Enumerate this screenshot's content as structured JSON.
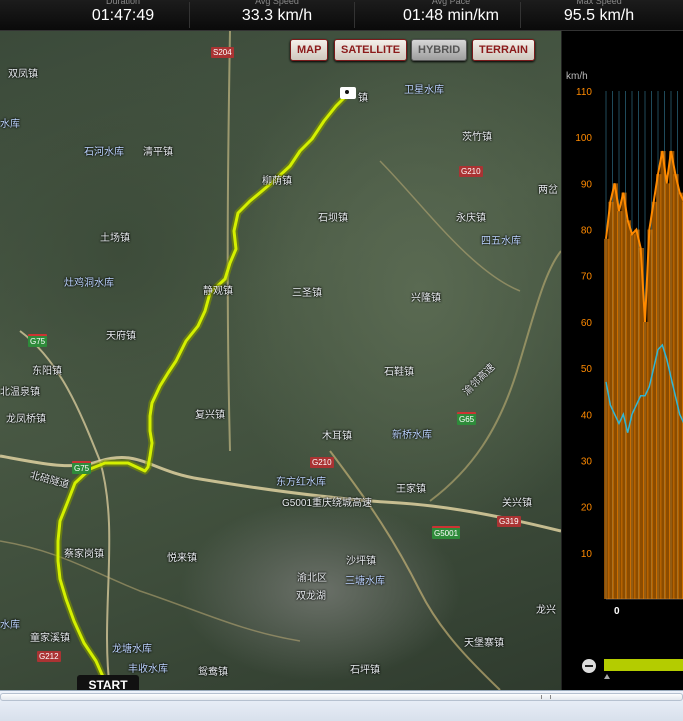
{
  "stats": [
    {
      "label": "Duration",
      "value": "01:47:49"
    },
    {
      "label": "Avg Speed",
      "value": "33.3 km/h"
    },
    {
      "label": "Avg Pace",
      "value": "01:48 min/km"
    },
    {
      "label": "Max Speed",
      "value": "95.5 km/h"
    }
  ],
  "map": {
    "types": [
      "MAP",
      "SATELLITE",
      "HYBRID",
      "TERRAIN"
    ],
    "active_type": "HYBRID",
    "start_label": "START",
    "camera_icon": "camera-icon",
    "route_color": "#d4f000",
    "towns": [
      {
        "t": "双凤镇",
        "w": false
      },
      {
        "t": "水库",
        "w": true
      },
      {
        "t": "石河水库",
        "w": true
      },
      {
        "t": "清平镇",
        "w": false
      },
      {
        "t": "土场镇",
        "w": false
      },
      {
        "t": "灶鸡洞水库",
        "w": true
      },
      {
        "t": "天府镇",
        "w": false
      },
      {
        "t": "东阳镇",
        "w": false
      },
      {
        "t": "北温泉镇",
        "w": false
      },
      {
        "t": "龙凤桥镇",
        "w": false
      },
      {
        "t": "柳荫镇",
        "w": false
      },
      {
        "t": "石坝镇",
        "w": false
      },
      {
        "t": "静观镇",
        "w": false
      },
      {
        "t": "三圣镇",
        "w": false
      },
      {
        "t": "复兴镇",
        "w": false
      },
      {
        "t": "卫星水库",
        "w": true
      },
      {
        "t": "茨竹镇",
        "w": false
      },
      {
        "t": "永庆镇",
        "w": false
      },
      {
        "t": "四五水库",
        "w": true
      },
      {
        "t": "兴隆镇",
        "w": false
      },
      {
        "t": "石鞋镇",
        "w": false
      },
      {
        "t": "木耳镇",
        "w": false
      },
      {
        "t": "新桥水库",
        "w": true
      },
      {
        "t": "东方红水库",
        "w": true
      },
      {
        "t": "王家镇",
        "w": false
      },
      {
        "t": "关兴镇",
        "w": false
      },
      {
        "t": "蔡家岗镇",
        "w": false
      },
      {
        "t": "悦来镇",
        "w": false
      },
      {
        "t": "沙坪镇",
        "w": false
      },
      {
        "t": "渝北区",
        "w": false
      },
      {
        "t": "三塘水库",
        "w": true
      },
      {
        "t": "双龙湖",
        "w": false
      },
      {
        "t": "童家溪镇",
        "w": false
      },
      {
        "t": "龙塘水库",
        "w": true
      },
      {
        "t": "丰收水库",
        "w": true
      },
      {
        "t": "鸳鸯镇",
        "w": false
      },
      {
        "t": "石坪镇",
        "w": false
      },
      {
        "t": "天堡寨镇",
        "w": false
      },
      {
        "t": "镇",
        "w": false
      },
      {
        "t": "两岔",
        "w": false
      },
      {
        "t": "北碚隧道",
        "w": false
      },
      {
        "t": "G5001重庆绕城高速",
        "w": false
      },
      {
        "t": "水库",
        "w": true
      },
      {
        "t": "渝邻高速",
        "w": false
      },
      {
        "t": "龙兴",
        "w": false
      },
      {
        "t": "水库",
        "w": true
      }
    ],
    "shields": [
      {
        "t": "S204",
        "c": "red"
      },
      {
        "t": "G210",
        "c": "red"
      },
      {
        "t": "G75",
        "c": "green"
      },
      {
        "t": "G65",
        "c": "green"
      },
      {
        "t": "G210",
        "c": "red"
      },
      {
        "t": "G5001",
        "c": "green"
      },
      {
        "t": "G319",
        "c": "red"
      },
      {
        "t": "G212",
        "c": "red"
      },
      {
        "t": "G75",
        "c": "green"
      }
    ]
  },
  "chart_data": {
    "type": "area",
    "ylabel": "km/h",
    "yticks": [
      10,
      20,
      30,
      40,
      50,
      60,
      70,
      80,
      90,
      100,
      110
    ],
    "ylim": [
      0,
      110
    ],
    "xticks": [
      "0"
    ],
    "series": [
      {
        "color": "#ff8a00",
        "values": [
          78,
          86,
          90,
          84,
          88,
          82,
          79,
          80,
          76,
          60,
          80,
          86,
          92,
          97,
          90,
          97,
          92,
          88,
          86
        ]
      },
      {
        "color": "#2fb6d6",
        "values": [
          47,
          42,
          40,
          38,
          40,
          36,
          40,
          42,
          44,
          44,
          46,
          50,
          54,
          55,
          52,
          48,
          44,
          40,
          38
        ]
      }
    ]
  },
  "zoom": {
    "minus_icon": "zoom-out-icon"
  }
}
